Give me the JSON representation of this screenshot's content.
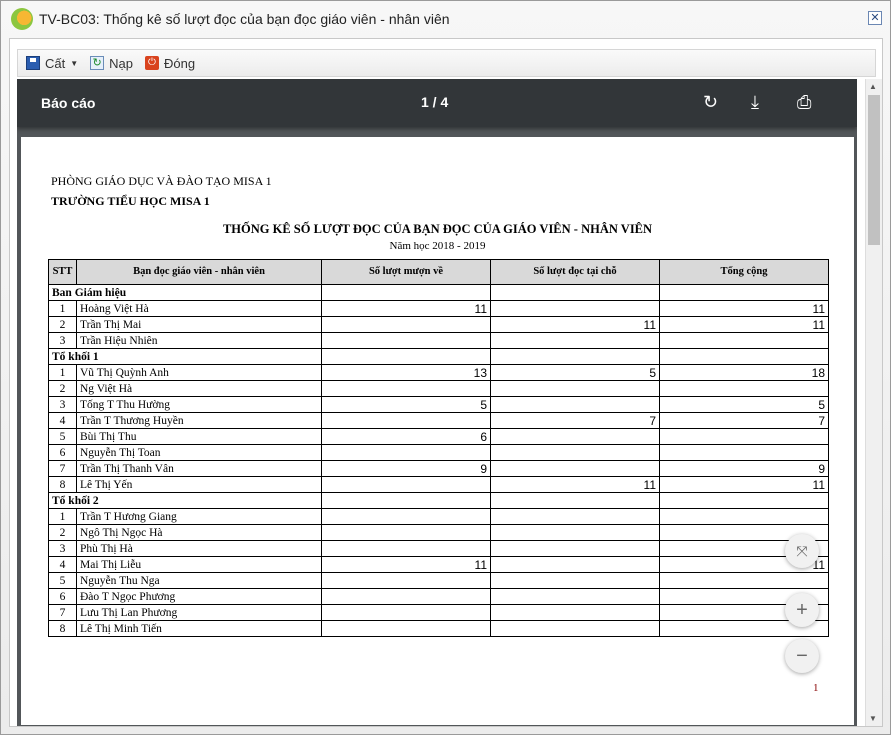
{
  "window": {
    "title": "TV-BC03: Thống kê số lượt đọc của bạn đọc giáo viên - nhân viên",
    "close": "✕"
  },
  "toolbar": {
    "save": "Cất",
    "reload": "Nạp",
    "close": "Đóng"
  },
  "viewer": {
    "title": "Báo cáo",
    "page": "1  /  4",
    "rotate": "↻",
    "download": "⤓",
    "print": "⎙",
    "fit": "⤧",
    "zoom_in": "+",
    "zoom_out": "−",
    "page_number": "1"
  },
  "report": {
    "org": "PHÒNG GIÁO DỤC VÀ ĐÀO TẠO MISA 1",
    "school": "TRƯỜNG TIỂU HỌC MISA 1",
    "title": "THỐNG KÊ SỐ LƯỢT ĐỌC CỦA BẠN ĐỌC CỦA GIÁO VIÊN - NHÂN VIÊN",
    "year": "Năm học 2018 - 2019",
    "headers": [
      "STT",
      "Bạn đọc giáo viên - nhân viên",
      "Số lượt mượn về",
      "Số lượt đọc tại chỗ",
      "Tổng cộng"
    ],
    "groups": [
      {
        "name": "Ban Giám hiệu",
        "rows": [
          [
            "1",
            "Hoàng Việt Hà",
            "11",
            "",
            "11"
          ],
          [
            "2",
            "Trần Thị Mai",
            "",
            "11",
            "11"
          ],
          [
            "3",
            "Trần Hiệu Nhiên",
            "",
            "",
            ""
          ]
        ]
      },
      {
        "name": "Tổ khối 1",
        "rows": [
          [
            "1",
            "Vũ Thị Quỳnh Anh",
            "13",
            "5",
            "18"
          ],
          [
            "2",
            "Ng Việt Hà",
            "",
            "",
            ""
          ],
          [
            "3",
            "Tống T Thu Hường",
            "5",
            "",
            "5"
          ],
          [
            "4",
            "Trần T Thương Huyền",
            "",
            "7",
            "7"
          ],
          [
            "5",
            "Bùi Thị Thu",
            "6",
            "",
            ""
          ],
          [
            "6",
            "Nguyễn Thị Toan",
            "",
            "",
            ""
          ],
          [
            "7",
            "Trần Thị Thanh Vân",
            "9",
            "",
            "9"
          ],
          [
            "8",
            "Lê Thị Yến",
            "",
            "11",
            "11"
          ]
        ]
      },
      {
        "name": "Tổ khối 2",
        "rows": [
          [
            "1",
            "Trần T Hương Giang",
            "",
            "",
            ""
          ],
          [
            "2",
            "Ngô Thị Ngọc Hà",
            "",
            "",
            ""
          ],
          [
            "3",
            "Phù Thị Hà",
            "",
            "",
            ""
          ],
          [
            "4",
            "Mai Thị Liễu",
            "11",
            "",
            "11"
          ],
          [
            "5",
            "Nguyễn Thu Nga",
            "",
            "",
            ""
          ],
          [
            "6",
            "Đào  T Ngọc Phương",
            "",
            "",
            ""
          ],
          [
            "7",
            "Lưu Thị Lan Phương",
            "",
            "",
            ""
          ],
          [
            "8",
            "Lê Thị Minh Tiến",
            "",
            "",
            ""
          ]
        ]
      }
    ]
  }
}
